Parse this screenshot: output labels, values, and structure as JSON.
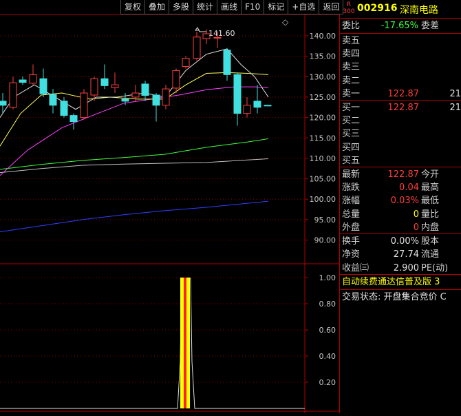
{
  "toolbar": {
    "buttons": [
      "复权",
      "叠加",
      "多股",
      "统计",
      "画线",
      "F10",
      "标记",
      "+自选",
      "返回"
    ]
  },
  "chart": {
    "max_label": "141.60",
    "price_axis": [
      "140.00",
      "135.00",
      "130.00",
      "125.00",
      "120.00",
      "115.00",
      "110.00",
      "105.00",
      "100.00",
      "95.00",
      "90.00"
    ],
    "indicator_axis": [
      "1.00",
      "0.80",
      "0.60",
      "0.40",
      "0.20"
    ],
    "diamond": "◇",
    "colors": {
      "up": "#ff4040",
      "down": "#40e0e0",
      "ma5": "#e0e0e0",
      "ma10": "#ffff60",
      "ma20": "#ff40ff",
      "ma60": "#40ff40",
      "ma120": "#c0c0c0",
      "ma250": "#3040ff",
      "grid": "#8b0000"
    }
  },
  "stock": {
    "r_badge": "R",
    "r_number": "300",
    "code": "002916",
    "name": "深南电路"
  },
  "quote": {
    "weibi_label": "委比",
    "weibi_value": "-17.65%",
    "weicha_label": "委差",
    "sell": [
      {
        "label": "卖五",
        "price": "",
        "vol": ""
      },
      {
        "label": "卖四",
        "price": "",
        "vol": ""
      },
      {
        "label": "卖三",
        "price": "",
        "vol": ""
      },
      {
        "label": "卖二",
        "price": "",
        "vol": ""
      },
      {
        "label": "卖一",
        "price": "122.87",
        "vol": "21"
      }
    ],
    "buy": [
      {
        "label": "买一",
        "price": "122.87",
        "vol": "21"
      },
      {
        "label": "买二",
        "price": "",
        "vol": ""
      },
      {
        "label": "买三",
        "price": "",
        "vol": ""
      },
      {
        "label": "买四",
        "price": "",
        "vol": ""
      },
      {
        "label": "买五",
        "price": "",
        "vol": ""
      }
    ],
    "stats": [
      {
        "l1": "最新",
        "v": "122.87",
        "c": "red",
        "l2": "今开"
      },
      {
        "l1": "涨跌",
        "v": "0.04",
        "c": "red",
        "l2": "最高"
      },
      {
        "l1": "涨幅",
        "v": "0.03%",
        "c": "red",
        "l2": "最低"
      },
      {
        "l1": "总量",
        "v": "0",
        "c": "yellow",
        "l2": "量比"
      },
      {
        "l1": "外盘",
        "v": "0",
        "c": "red",
        "l2": "内盘"
      }
    ],
    "fin": [
      {
        "l1": "换手",
        "v": "0.00%",
        "l2": "股本"
      },
      {
        "l1": "净资",
        "v": "27.74",
        "l2": "流通"
      },
      {
        "l1": "收益㈢",
        "v": "2.900",
        "l2": "PE(动)"
      }
    ],
    "ticker": "自动续费通达信普及版 3",
    "trade_status": "交易状态: 开盘集合竞价 C"
  }
}
